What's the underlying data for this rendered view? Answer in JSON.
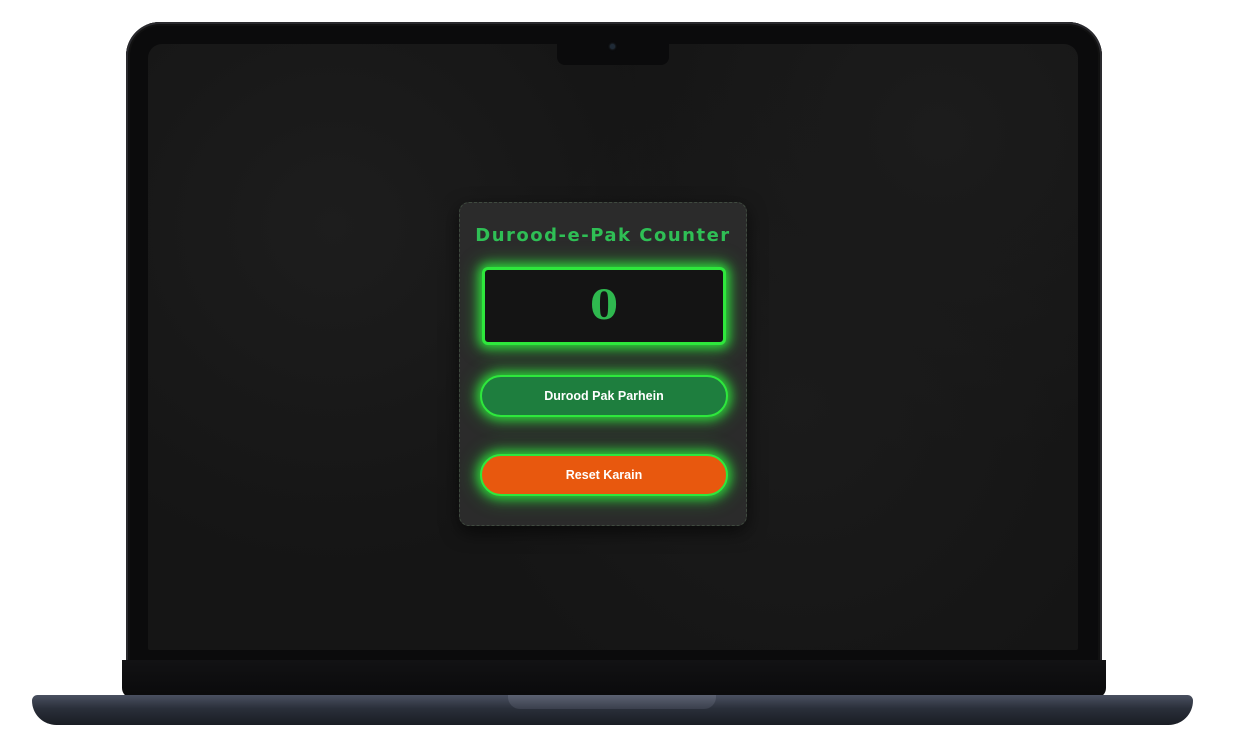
{
  "app": {
    "title": "Durood-e-Pak Counter",
    "count": "0",
    "buttons": {
      "count_label": "Durood Pak Parhein",
      "reset_label": "Reset Karain"
    }
  },
  "colors": {
    "accent_green": "#2ee83c",
    "title_green": "#2fbf55",
    "count_button": "#1e7e3e",
    "reset_button": "#e8580e",
    "card_bg": "#2b2b2b",
    "screen_bg": "#151515"
  }
}
